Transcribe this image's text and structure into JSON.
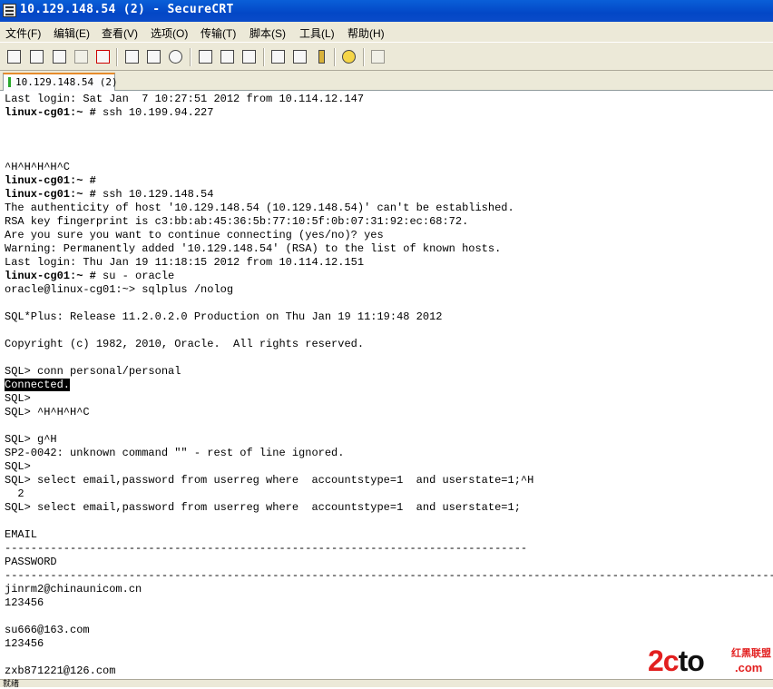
{
  "window": {
    "title": "10.129.148.54 (2) - SecureCRT"
  },
  "menu": [
    "文件(F)",
    "编辑(E)",
    "查看(V)",
    "选项(O)",
    "传输(T)",
    "脚本(S)",
    "工具(L)",
    "帮助(H)"
  ],
  "toolbar": {
    "buttons": [
      "connect-icon",
      "quick-connect-icon",
      "connect-tab-icon",
      "reconnect-icon",
      "disconnect-icon",
      "copy-icon",
      "paste-icon",
      "find-icon",
      "print-icon",
      "print-selection-icon",
      "print-setup-icon",
      "session-options-icon",
      "global-options-icon",
      "keymap-icon",
      "help-icon",
      "sftp-icon"
    ]
  },
  "tab": {
    "label": "10.129.148.54 (2)"
  },
  "terminal": {
    "lines": [
      {
        "text": "Last login: Sat Jan  7 10:27:51 2012 from 10.114.12.147"
      },
      {
        "prompt": "linux-cg01:~ #",
        "text": " ssh 10.199.94.227"
      },
      {
        "text": ""
      },
      {
        "text": ""
      },
      {
        "text": ""
      },
      {
        "text": "^H^H^H^H^C"
      },
      {
        "prompt": "linux-cg01:~ #",
        "text": ""
      },
      {
        "prompt": "linux-cg01:~ #",
        "text": " ssh 10.129.148.54"
      },
      {
        "text": "The authenticity of host '10.129.148.54 (10.129.148.54)' can't be established."
      },
      {
        "text": "RSA key fingerprint is c3:bb:ab:45:36:5b:77:10:5f:0b:07:31:92:ec:68:72."
      },
      {
        "text": "Are you sure you want to continue connecting (yes/no)? yes"
      },
      {
        "text": "Warning: Permanently added '10.129.148.54' (RSA) to the list of known hosts."
      },
      {
        "text": "Last login: Thu Jan 19 11:18:15 2012 from 10.114.12.151"
      },
      {
        "prompt": "linux-cg01:~ #",
        "text": " su - oracle"
      },
      {
        "text": "oracle@linux-cg01:~> sqlplus /nolog"
      },
      {
        "text": ""
      },
      {
        "text": "SQL*Plus: Release 11.2.0.2.0 Production on Thu Jan 19 11:19:48 2012"
      },
      {
        "text": ""
      },
      {
        "text": "Copyright (c) 1982, 2010, Oracle.  All rights reserved."
      },
      {
        "text": ""
      },
      {
        "text": "SQL> conn personal/personal"
      },
      {
        "highlight": "Connected.",
        "text": ""
      },
      {
        "text": "SQL>"
      },
      {
        "text": "SQL> ^H^H^H^C"
      },
      {
        "text": ""
      },
      {
        "text": "SQL> g^H"
      },
      {
        "text": "SP2-0042: unknown command \"\" - rest of line ignored."
      },
      {
        "text": "SQL>"
      },
      {
        "text": "SQL> select email,password from userreg where  accountstype=1  and userstate=1;^H"
      },
      {
        "text": "  2"
      },
      {
        "text": "SQL> select email,password from userreg where  accountstype=1  and userstate=1;"
      },
      {
        "text": ""
      },
      {
        "text": "EMAIL"
      },
      {
        "text": "--------------------------------------------------------------------------------"
      },
      {
        "text": "PASSWORD"
      },
      {
        "text": "--------------------------------------------------------------------------------------------------------------------------------"
      },
      {
        "text": "jinrm2@chinaunicom.cn"
      },
      {
        "text": "123456"
      },
      {
        "text": ""
      },
      {
        "text": "su666@163.com"
      },
      {
        "text": "123456"
      },
      {
        "text": ""
      },
      {
        "text": "zxb871221@126.com"
      }
    ]
  },
  "statusbar": {
    "text": "就绪"
  },
  "watermark": {
    "main_red": "2c",
    "main_black": "to",
    "com": ".com",
    "cn": "红黑联盟"
  }
}
